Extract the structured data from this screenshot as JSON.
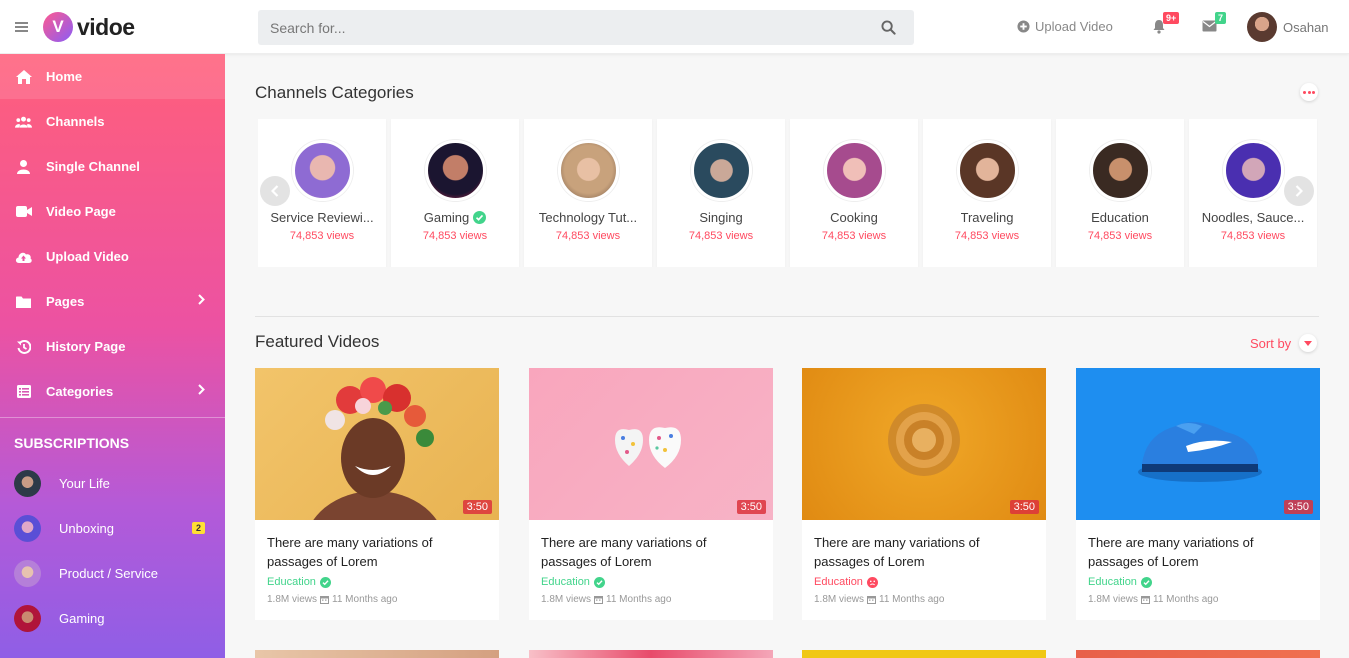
{
  "header": {
    "logo_letter": "V",
    "logo_text": "vidoe",
    "search_placeholder": "Search for...",
    "upload_label": "Upload Video",
    "notif_count": "9+",
    "message_count": "7",
    "user_name": "Osahan"
  },
  "sidebar": {
    "items": [
      {
        "label": "Home",
        "icon": "home-icon"
      },
      {
        "label": "Channels",
        "icon": "users-icon"
      },
      {
        "label": "Single Channel",
        "icon": "user-icon"
      },
      {
        "label": "Video Page",
        "icon": "video-camera-icon"
      },
      {
        "label": "Upload Video",
        "icon": "cloud-upload-icon"
      },
      {
        "label": "Pages",
        "icon": "folder-icon"
      },
      {
        "label": "History Page",
        "icon": "history-icon"
      },
      {
        "label": "Categories",
        "icon": "list-icon"
      }
    ],
    "subscriptions_heading": "SUBSCRIPTIONS",
    "subscriptions": [
      {
        "label": "Your Life",
        "count": ""
      },
      {
        "label": "Unboxing",
        "count": "2"
      },
      {
        "label": "Product / Service",
        "count": ""
      },
      {
        "label": "Gaming",
        "count": ""
      }
    ]
  },
  "categories": {
    "title": "Channels Categories",
    "items": [
      {
        "name": "Service Reviewi...",
        "views": "74,853 views",
        "verified": false
      },
      {
        "name": "Gaming",
        "views": "74,853 views",
        "verified": true
      },
      {
        "name": "Technology Tut...",
        "views": "74,853 views",
        "verified": false
      },
      {
        "name": "Singing",
        "views": "74,853 views",
        "verified": false
      },
      {
        "name": "Cooking",
        "views": "74,853 views",
        "verified": false
      },
      {
        "name": "Traveling",
        "views": "74,853 views",
        "verified": false
      },
      {
        "name": "Education",
        "views": "74,853 views",
        "verified": false
      },
      {
        "name": "Noodles, Sauce...",
        "views": "74,853 views",
        "verified": false
      }
    ]
  },
  "featured": {
    "title": "Featured Videos",
    "sort_label": "Sort by",
    "videos": [
      {
        "duration": "3:50",
        "title": "There are many variations of passages of Lorem",
        "category": "Education",
        "status": "verified",
        "views": "1.8M views",
        "age": "11 Months ago"
      },
      {
        "duration": "3:50",
        "title": "There are many variations of passages of Lorem",
        "category": "Education",
        "status": "verified",
        "views": "1.8M views",
        "age": "11 Months ago"
      },
      {
        "duration": "3:50",
        "title": "There are many variations of passages of Lorem",
        "category": "Education",
        "status": "unavailable",
        "views": "1.8M views",
        "age": "11 Months ago"
      },
      {
        "duration": "3:50",
        "title": "There are many variations of passages of Lorem",
        "category": "Education",
        "status": "verified",
        "views": "1.8M views",
        "age": "11 Months ago"
      }
    ]
  },
  "colors": {
    "accent": "#ff4a60",
    "verified": "#42d48b",
    "sidebar_top": "#ff5f7b",
    "sidebar_bottom": "#8f5ee6"
  }
}
